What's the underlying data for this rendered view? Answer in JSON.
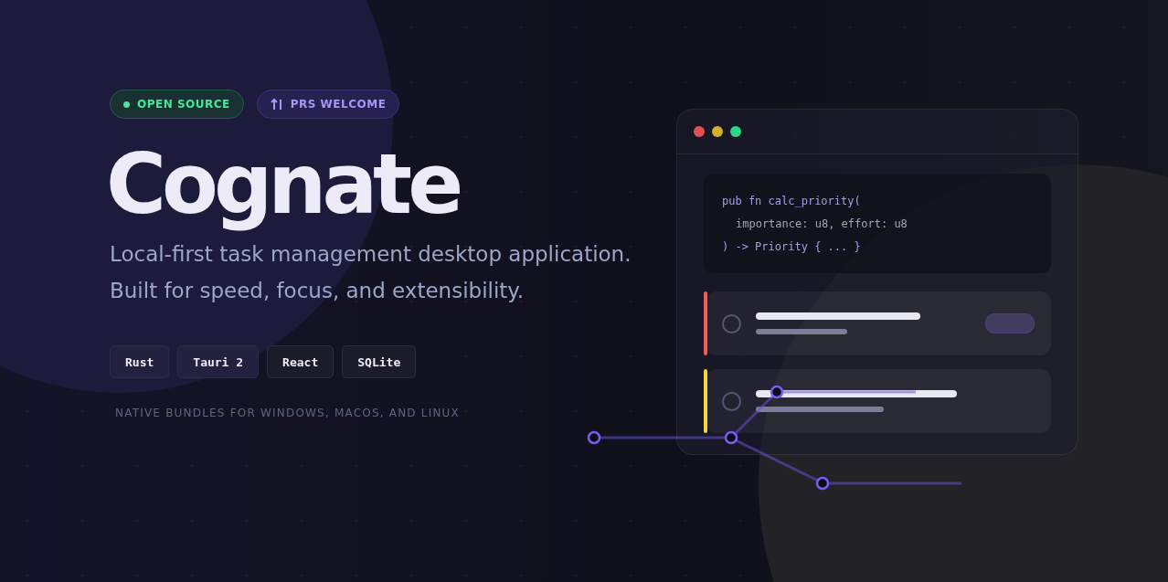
{
  "badges": [
    {
      "label": "OPEN SOURCE",
      "kind": "dot"
    },
    {
      "label": "PRS WELCOME",
      "kind": "merge"
    }
  ],
  "title": "Cognate",
  "tagline": [
    "Local-first task management desktop application.",
    "Built for speed, focus, and extensibility."
  ],
  "stack": [
    "Rust",
    "Tauri 2",
    "React",
    "SQLite"
  ],
  "platforms": "NATIVE BUNDLES FOR WINDOWS, MACOS, AND LINUX",
  "preview": {
    "window_dots": [
      {
        "color": "#e05252"
      },
      {
        "color": "#d4b22e"
      },
      {
        "color": "#2ed48a"
      }
    ],
    "code": [
      {
        "text": "pub fn calc_priority(",
        "kind": "keyword"
      },
      {
        "text": "importance: u8, effort: u8",
        "kind": "param"
      },
      {
        "text": ") -> Priority { ... }",
        "kind": "keyword"
      }
    ],
    "tasks": [
      {
        "color": "#f05a5a",
        "checked": false,
        "tagged": true
      },
      {
        "color": "#f5d63d",
        "checked": false,
        "tagged": false
      }
    ]
  }
}
